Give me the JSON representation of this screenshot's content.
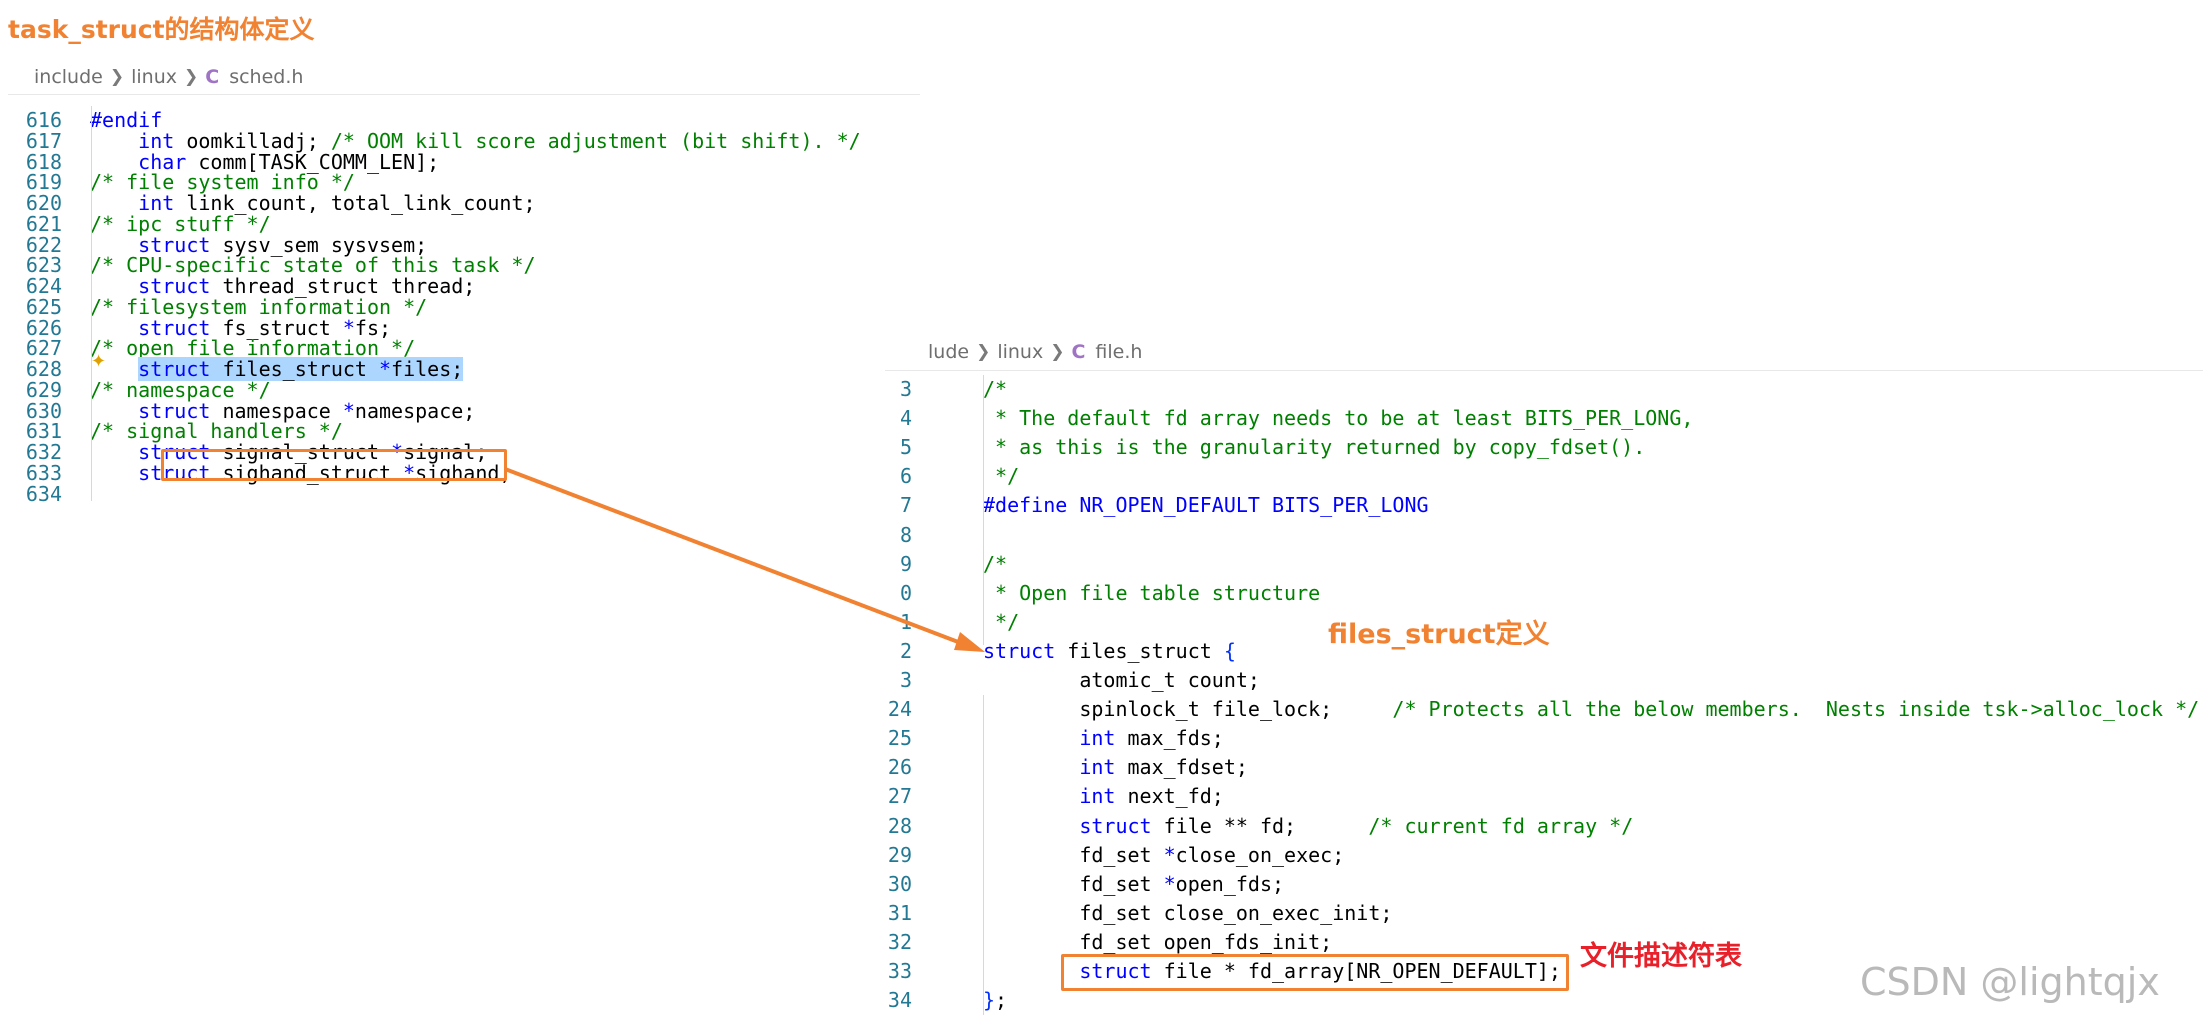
{
  "annotations": {
    "top_title": "task_struct的结构体定义",
    "files_struct_def": "files_struct定义",
    "fd_table": "文件描述符表",
    "watermark": "CSDN @lightqjx",
    "colors": {
      "orange": "#f08232",
      "red": "#e8202a"
    }
  },
  "left_panel": {
    "breadcrumb": [
      "include",
      "linux",
      "sched.h"
    ],
    "file_icon": "C",
    "partial_top_line": "        int  link_count_  total_link_count;",
    "lines": [
      {
        "n": "616",
        "parts": [
          {
            "t": "#endif",
            "c": "pp"
          }
        ]
      },
      {
        "n": "617",
        "parts": [
          {
            "t": "    "
          },
          {
            "t": "int",
            "c": "kw"
          },
          {
            "t": " oomkilladj; "
          },
          {
            "t": "/* OOM kill score adjustment (bit shift). */",
            "c": "cm"
          }
        ]
      },
      {
        "n": "618",
        "parts": [
          {
            "t": "    "
          },
          {
            "t": "char",
            "c": "kw"
          },
          {
            "t": " comm["
          },
          {
            "t": "TASK_COMM_LEN",
            "c": "pl"
          },
          {
            "t": "];"
          }
        ]
      },
      {
        "n": "619",
        "parts": [
          {
            "t": "/* file system info */",
            "c": "cm"
          }
        ]
      },
      {
        "n": "620",
        "parts": [
          {
            "t": "    "
          },
          {
            "t": "int",
            "c": "kw"
          },
          {
            "t": " link_count, total_link_count;"
          }
        ]
      },
      {
        "n": "621",
        "parts": [
          {
            "t": "/* ipc stuff */",
            "c": "cm"
          }
        ]
      },
      {
        "n": "622",
        "parts": [
          {
            "t": "    "
          },
          {
            "t": "struct",
            "c": "kw"
          },
          {
            "t": " sysv_sem sysvsem;"
          }
        ]
      },
      {
        "n": "623",
        "parts": [
          {
            "t": "/* CPU-specific state of this task */",
            "c": "cm"
          }
        ]
      },
      {
        "n": "624",
        "parts": [
          {
            "t": "    "
          },
          {
            "t": "struct",
            "c": "kw"
          },
          {
            "t": " thread_struct thread;"
          }
        ]
      },
      {
        "n": "625",
        "parts": [
          {
            "t": "/* filesystem information */",
            "c": "cm"
          }
        ]
      },
      {
        "n": "626",
        "parts": [
          {
            "t": "    "
          },
          {
            "t": "struct",
            "c": "kw"
          },
          {
            "t": " fs_struct "
          },
          {
            "t": "*",
            "c": "kw"
          },
          {
            "t": "fs;"
          }
        ]
      },
      {
        "n": "627",
        "parts": [
          {
            "t": "/* open file information */",
            "c": "cm"
          }
        ]
      },
      {
        "n": "628",
        "parts": [
          {
            "t": "    "
          },
          {
            "t": "struct",
            "c": "kw sel"
          },
          {
            "t": " files_struct ",
            "c": "sel"
          },
          {
            "t": "*",
            "c": "kw sel"
          },
          {
            "t": "files;",
            "c": "sel"
          }
        ]
      },
      {
        "n": "629",
        "parts": [
          {
            "t": "/* namespace */",
            "c": "cm"
          }
        ]
      },
      {
        "n": "630",
        "parts": [
          {
            "t": "    "
          },
          {
            "t": "struct",
            "c": "kw"
          },
          {
            "t": " namespace "
          },
          {
            "t": "*",
            "c": "kw"
          },
          {
            "t": "namespace;"
          }
        ]
      },
      {
        "n": "631",
        "parts": [
          {
            "t": "/* signal handlers */",
            "c": "cm"
          }
        ]
      },
      {
        "n": "632",
        "parts": [
          {
            "t": "    "
          },
          {
            "t": "struct",
            "c": "kw"
          },
          {
            "t": " signal_struct "
          },
          {
            "t": "*",
            "c": "kw"
          },
          {
            "t": "signal;"
          }
        ]
      },
      {
        "n": "633",
        "parts": [
          {
            "t": "    "
          },
          {
            "t": "struct",
            "c": "kw"
          },
          {
            "t": " sighand_struct "
          },
          {
            "t": "*",
            "c": "kw"
          },
          {
            "t": "sighand;"
          }
        ]
      },
      {
        "n": "634",
        "parts": []
      }
    ],
    "sparkle_icon": "sparkle-icon"
  },
  "right_panel": {
    "breadcrumb": [
      "lude",
      "linux",
      "file.h"
    ],
    "file_icon": "C",
    "lines": [
      {
        "n": "3",
        "parts": [
          {
            "t": "/*",
            "c": "cm"
          }
        ]
      },
      {
        "n": "4",
        "parts": [
          {
            "t": " * The default fd array needs to be at least BITS_PER_LONG,",
            "c": "cm"
          }
        ]
      },
      {
        "n": "5",
        "parts": [
          {
            "t": " * as this is the granularity returned by copy_fdset().",
            "c": "cm"
          }
        ]
      },
      {
        "n": "6",
        "parts": [
          {
            "t": " */",
            "c": "cm"
          }
        ]
      },
      {
        "n": "7",
        "parts": [
          {
            "t": "#define",
            "c": "pp"
          },
          {
            "t": " NR_OPEN_DEFAULT BITS_PER_LONG",
            "c": "pp"
          }
        ]
      },
      {
        "n": "8",
        "parts": []
      },
      {
        "n": "9",
        "parts": [
          {
            "t": "/*",
            "c": "cm"
          }
        ]
      },
      {
        "n": "0",
        "parts": [
          {
            "t": " * Open file table structure",
            "c": "cm"
          }
        ]
      },
      {
        "n": "1",
        "parts": [
          {
            "t": " */",
            "c": "cm"
          }
        ]
      },
      {
        "n": "2",
        "parts": [
          {
            "t": "struct",
            "c": "kw"
          },
          {
            "t": " files_struct "
          },
          {
            "t": "{",
            "c": "brace"
          }
        ]
      },
      {
        "n": "3",
        "parts": [
          {
            "t": "        atomic_t count;"
          }
        ]
      },
      {
        "n": "24",
        "parts": [
          {
            "t": "        spinlock_t file_lock;     "
          },
          {
            "t": "/* Protects all the below members.  Nests inside tsk->alloc_lock */",
            "c": "cm"
          }
        ]
      },
      {
        "n": "25",
        "parts": [
          {
            "t": "        "
          },
          {
            "t": "int",
            "c": "kw"
          },
          {
            "t": " max_fds;"
          }
        ]
      },
      {
        "n": "26",
        "parts": [
          {
            "t": "        "
          },
          {
            "t": "int",
            "c": "kw"
          },
          {
            "t": " max_fdset;"
          }
        ]
      },
      {
        "n": "27",
        "parts": [
          {
            "t": "        "
          },
          {
            "t": "int",
            "c": "kw"
          },
          {
            "t": " next_fd;"
          }
        ]
      },
      {
        "n": "28",
        "parts": [
          {
            "t": "        "
          },
          {
            "t": "struct",
            "c": "kw"
          },
          {
            "t": " file ** fd;      "
          },
          {
            "t": "/* current fd array */",
            "c": "cm"
          }
        ]
      },
      {
        "n": "29",
        "parts": [
          {
            "t": "        fd_set "
          },
          {
            "t": "*",
            "c": "kw"
          },
          {
            "t": "close_on_exec;"
          }
        ]
      },
      {
        "n": "30",
        "parts": [
          {
            "t": "        fd_set "
          },
          {
            "t": "*",
            "c": "kw"
          },
          {
            "t": "open_fds;"
          }
        ]
      },
      {
        "n": "31",
        "parts": [
          {
            "t": "        fd_set close_on_exec_init;"
          }
        ]
      },
      {
        "n": "32",
        "parts": [
          {
            "t": "        fd_set open_fds_init;"
          }
        ]
      },
      {
        "n": "33",
        "parts": [
          {
            "t": "        "
          },
          {
            "t": "struct",
            "c": "kw"
          },
          {
            "t": " file * fd_array[NR_OPEN_DEFAULT];"
          }
        ]
      },
      {
        "n": "34",
        "parts": [
          {
            "t": "}",
            "c": "brace"
          },
          {
            "t": ";"
          }
        ]
      }
    ]
  }
}
